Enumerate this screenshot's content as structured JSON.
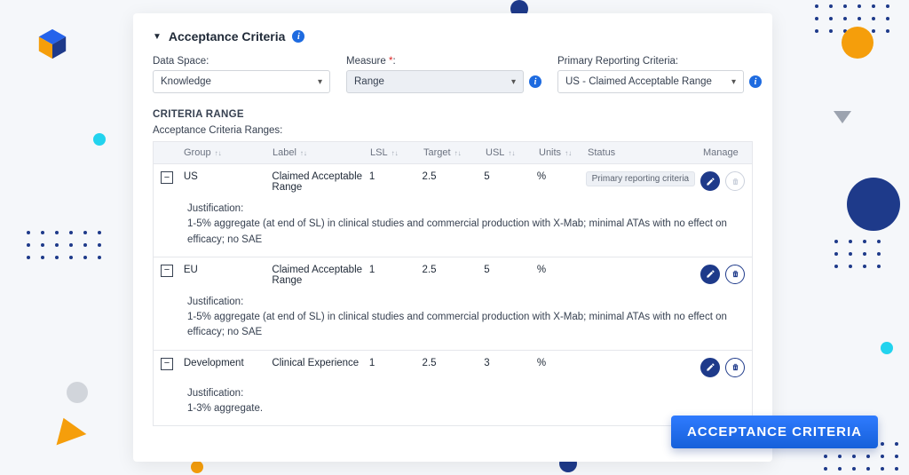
{
  "section": {
    "title": "Acceptance Criteria"
  },
  "filters": {
    "dataSpace": {
      "label": "Data Space:",
      "value": "Knowledge"
    },
    "measure": {
      "label": "Measure",
      "req": "*",
      "colon": ":",
      "value": "Range"
    },
    "primary": {
      "label": "Primary Reporting Criteria:",
      "value": "US - Claimed Acceptable Range"
    }
  },
  "criteria": {
    "heading": "CRITERIA RANGE",
    "sub": "Acceptance Criteria Ranges:",
    "columns": {
      "group": "Group",
      "label": "Label",
      "lsl": "LSL",
      "target": "Target",
      "usl": "USL",
      "units": "Units",
      "status": "Status",
      "manage": "Manage"
    },
    "rows": [
      {
        "group": "US",
        "label": "Claimed Acceptable Range",
        "lsl": "1",
        "target": "2.5",
        "usl": "5",
        "units": "%",
        "status": "Primary reporting criteria",
        "deletable": false,
        "justLabel": "Justification:",
        "justText": "1-5% aggregate (at end of SL) in clinical studies and commercial production with X-Mab; minimal ATAs with no effect on efficacy; no SAE"
      },
      {
        "group": "EU",
        "label": "Claimed Acceptable Range",
        "lsl": "1",
        "target": "2.5",
        "usl": "5",
        "units": "%",
        "status": "",
        "deletable": true,
        "justLabel": "Justification:",
        "justText": "1-5% aggregate (at end of SL) in clinical studies and commercial production with X-Mab; minimal ATAs with no effect on efficacy; no SAE"
      },
      {
        "group": "Development",
        "label": "Clinical Experience",
        "lsl": "1",
        "target": "2.5",
        "usl": "3",
        "units": "%",
        "status": "",
        "deletable": true,
        "justLabel": "Justification:",
        "justText": "1-3% aggregate."
      }
    ]
  },
  "banner": "ACCEPTANCE CRITERIA"
}
